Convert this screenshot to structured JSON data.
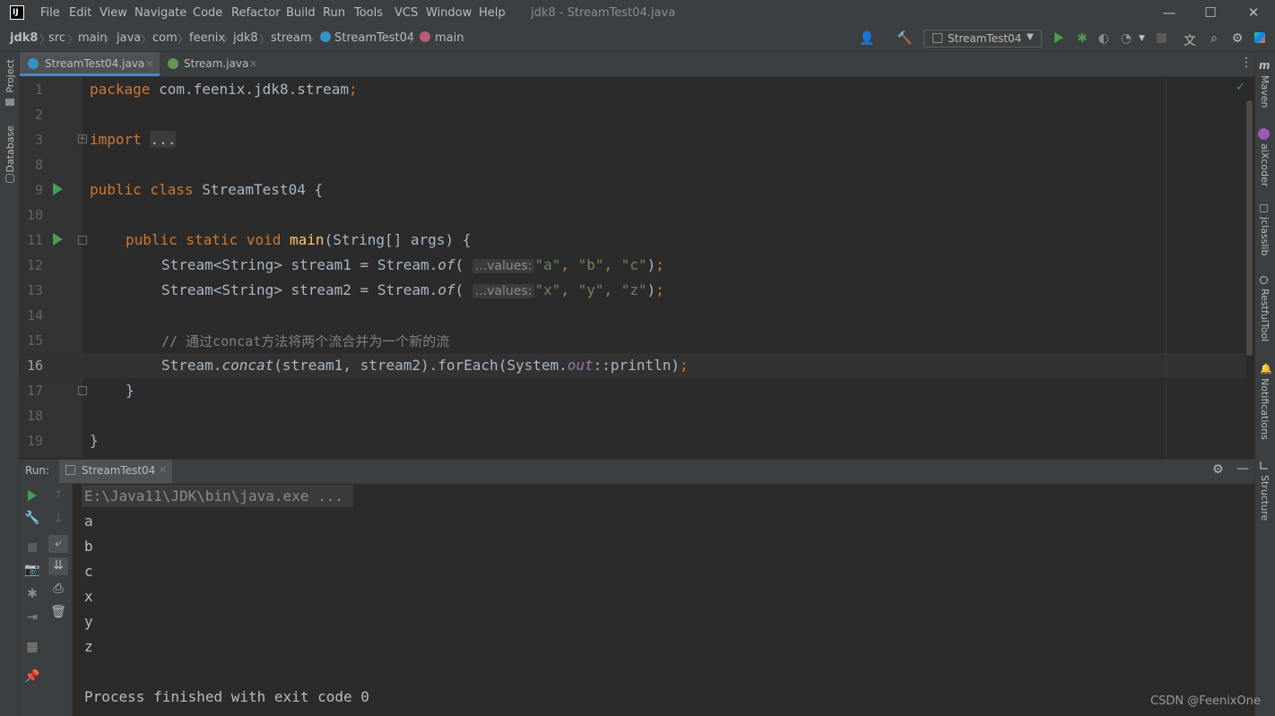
{
  "titlebar": {
    "menu": [
      "File",
      "Edit",
      "View",
      "Navigate",
      "Code",
      "Refactor",
      "Build",
      "Run",
      "Tools",
      "VCS",
      "Window",
      "Help"
    ],
    "window_title": "jdk8 - StreamTest04.java"
  },
  "breadcrumb": [
    "jdk8",
    "src",
    "main",
    "java",
    "com",
    "feenix",
    "jdk8",
    "stream",
    "StreamTest04",
    "main"
  ],
  "run_config": "StreamTest04",
  "tabs": [
    {
      "label": "StreamTest04.java",
      "active": true
    },
    {
      "label": "Stream.java",
      "active": false
    }
  ],
  "left_tools": [
    "Project",
    "Database"
  ],
  "right_tools": [
    "Maven",
    "aiXcoder",
    "jclasslib",
    "RestfulTool",
    "Notifications",
    "Structure"
  ],
  "editor": {
    "line_numbers": [
      "1",
      "2",
      "3",
      "8",
      "9",
      "10",
      "11",
      "12",
      "13",
      "14",
      "15",
      "16",
      "17",
      "18",
      "19"
    ],
    "package_kw": "package",
    "package_name": "com.feenix.jdk8.stream",
    "import_kw": "import",
    "import_fold": "...",
    "class_kw": "public class",
    "class_name": "StreamTest04",
    "method_kw": "public static void",
    "method_name": "main",
    "method_params": "(String[] args) {",
    "line12_a": "Stream<String> stream1 = Stream.",
    "of": "of",
    "hint": "...values:",
    "line12_args": [
      "\"a\"",
      "\"b\"",
      "\"c\""
    ],
    "line13_a": "Stream<String> stream2 = Stream.",
    "line13_args": [
      "\"x\"",
      "\"y\"",
      "\"z\""
    ],
    "comment": "// 通过concat方法将两个流合并为一个新的流",
    "line16_a": "Stream.",
    "concat": "concat",
    "line16_b": "(stream1, stream2).forEach(System.",
    "out": "out",
    "line16_c": "::println)",
    "close_method": "}",
    "close_class": "}"
  },
  "run_panel": {
    "label": "Run:",
    "tab": "StreamTest04",
    "command": "E:\\Java11\\JDK\\bin\\java.exe ...",
    "output": [
      "a",
      "b",
      "c",
      "x",
      "y",
      "z"
    ],
    "exit_message": "Process finished with exit code 0"
  },
  "watermark": "CSDN @FeenixOne",
  "colors": {
    "keyword": "#cc7832",
    "string": "#6a8759",
    "comment": "#808080",
    "function": "#ffc66d",
    "run": "#499c54"
  }
}
